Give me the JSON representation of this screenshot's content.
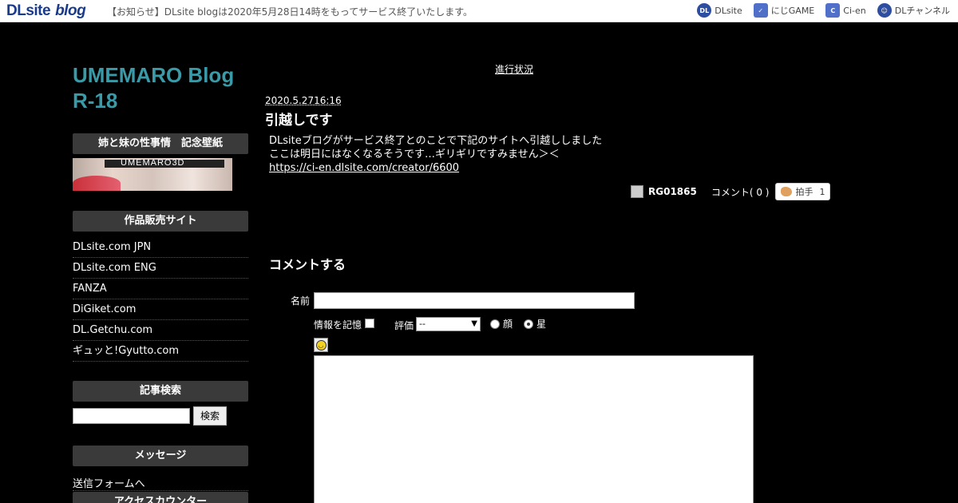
{
  "topbar": {
    "logo_dl": "DLsite",
    "logo_blog": "blog",
    "notice": "【お知らせ】DLsite blogは2020年5月28日14時をもってサービス終了いたします。",
    "links": [
      {
        "icon": "dlsite-icon",
        "label": "DLsite"
      },
      {
        "icon": "nijigame-icon",
        "label": "にじGAME"
      },
      {
        "icon": "cien-icon",
        "label": "Ci-en"
      },
      {
        "icon": "dlchannel-icon",
        "label": "DLチャンネル"
      }
    ]
  },
  "sidebar": {
    "blog_title": "UMEMARO Blog R-18",
    "wallpaper_heading": "姉と妹の性事情　記念壁紙",
    "banner_text": "UMEMARO3D",
    "sales_heading": "作品販売サイト",
    "sales_links": [
      "DLsite.com JPN",
      "DLsite.com ENG",
      "FANZA",
      "DiGiket.com",
      "DL.Getchu.com",
      "ギュッと!Gyutto.com"
    ],
    "search_heading": "記事検索",
    "search_button": "検索",
    "message_heading": "メッセージ",
    "message_link": "送信フォームへ",
    "counter_heading": "アクセスカウンター"
  },
  "main": {
    "status_link": "進行状況",
    "post": {
      "date": "2020.5.2716:16",
      "title": "引越しです",
      "body_lines": [
        "DLsiteブログがサービス終了とのことで下記のサイトへ引越ししました",
        "ここは明日にはなくなるそうです…ギリギリですみません＞＜"
      ],
      "link": "https://ci-en.dlsite.com/creator/6600",
      "author": "RG01865",
      "comments": "コメント( 0 )",
      "clap_label": "拍手",
      "clap_count": "1"
    },
    "comment_form": {
      "heading": "コメントする",
      "name_label": "名前",
      "remember_label": "情報を記憶",
      "rating_label": "評価",
      "rating_value": "--",
      "radio_face": "顔",
      "radio_star": "星"
    }
  }
}
